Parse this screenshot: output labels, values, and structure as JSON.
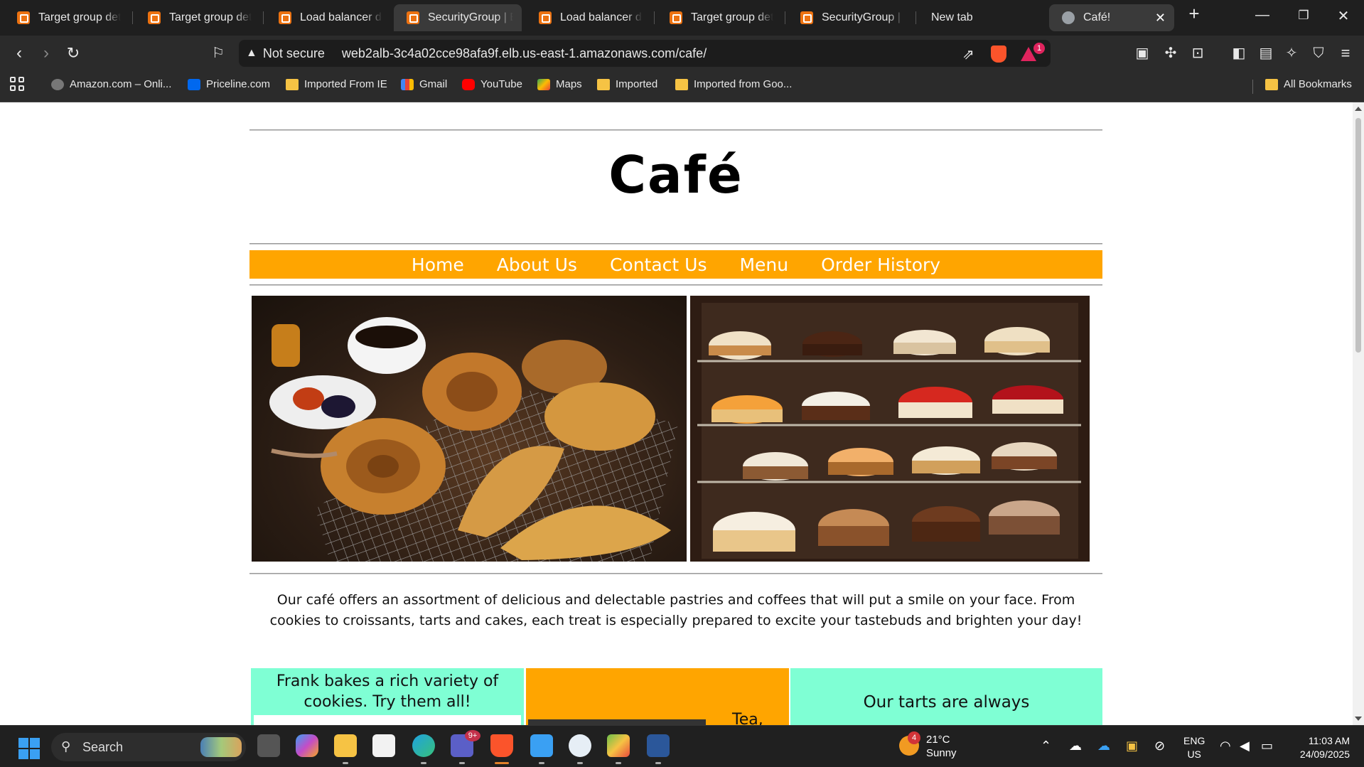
{
  "browser": {
    "tabs": [
      {
        "label": "Target group deta",
        "icon": "aws-icon"
      },
      {
        "label": "Target group deta",
        "icon": "aws-icon"
      },
      {
        "label": "Load balancer deta",
        "icon": "aws-icon"
      },
      {
        "label": "SecurityGroup | EC",
        "icon": "aws-icon"
      },
      {
        "label": "Load balancer deta",
        "icon": "aws-icon"
      },
      {
        "label": "Target group deta",
        "icon": "aws-icon"
      },
      {
        "label": "SecurityGroup | EC",
        "icon": "aws-icon"
      },
      {
        "label": "New tab",
        "icon": ""
      },
      {
        "label": "Café!",
        "icon": "globe-icon"
      }
    ],
    "new_tab": "+",
    "window": {
      "minimize": "—",
      "restore": "❐",
      "close": "✕"
    },
    "address": {
      "security_label": "Not secure",
      "url": "web2alb-3c4a02cce98afa9f.elb.us-east-1.amazonaws.com/cafe/"
    },
    "shields_badge": "1",
    "bookmarks": [
      {
        "label": "Amazon.com – Onli...",
        "icon": "amazon"
      },
      {
        "label": "Priceline.com",
        "icon": "priceline"
      },
      {
        "label": "Imported From IE",
        "icon": "folder"
      },
      {
        "label": "Gmail",
        "icon": "gmail"
      },
      {
        "label": "YouTube",
        "icon": "youtube"
      },
      {
        "label": "Maps",
        "icon": "maps"
      },
      {
        "label": "Imported",
        "icon": "folder"
      },
      {
        "label": "Imported from Goo...",
        "icon": "folder"
      }
    ],
    "all_bookmarks": "All Bookmarks"
  },
  "page": {
    "title": "Café",
    "nav": [
      "Home",
      "About Us",
      "Contact Us",
      "Menu",
      "Order History"
    ],
    "intro": "Our café offers an assortment of delicious and delectable pastries and coffees that will put a smile on your face. From cookies to croissants, tarts and cakes, each treat is especially prepared to excite your tastebuds and brighten your day!",
    "columns": {
      "cookies": "Frank bakes a rich variety of cookies. Try them all!",
      "tea": "Tea,",
      "tarts": "Our tarts are always"
    }
  },
  "taskbar": {
    "search_placeholder": "Search",
    "teams_badge": "9+",
    "weather": {
      "temp": "21°C",
      "condition": "Sunny",
      "badge": "4"
    },
    "language": {
      "lang": "ENG",
      "region": "US"
    },
    "clock": {
      "time": "11:03 AM",
      "date": "24/09/2025"
    }
  }
}
